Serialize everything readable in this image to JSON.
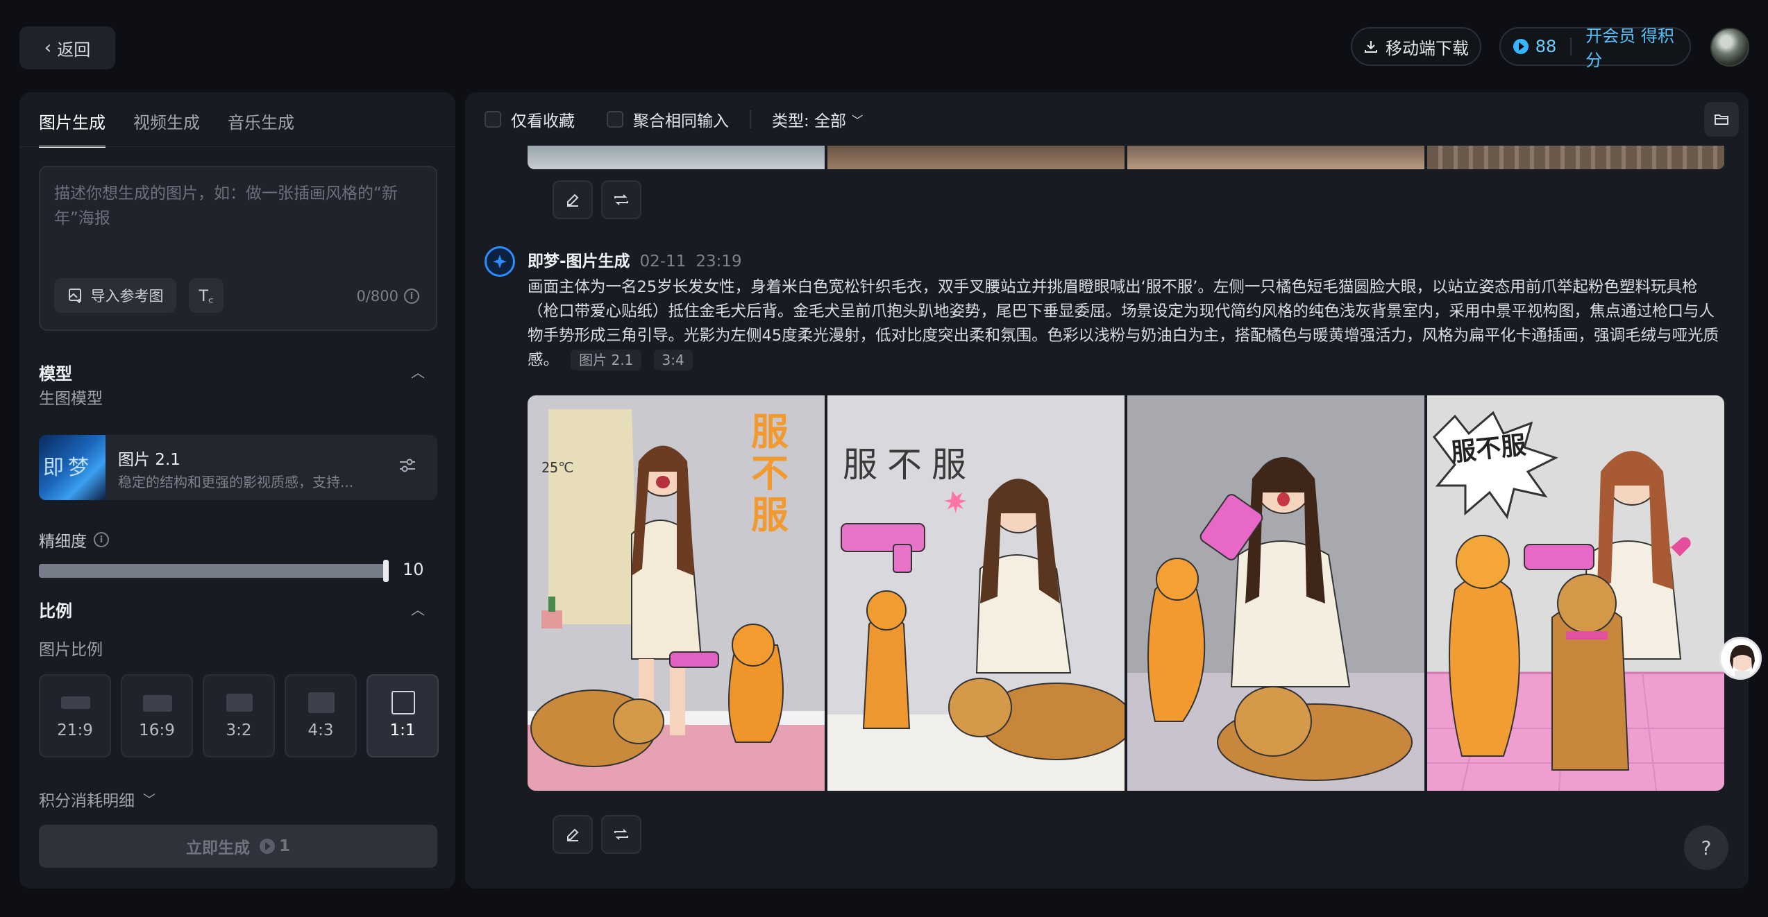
{
  "topbar": {
    "back_label": "返回",
    "mobile_download_label": "移动端下载",
    "points_value": "88",
    "membership_label": "开会员 得积分"
  },
  "left": {
    "tabs": [
      {
        "label": "图片生成",
        "active": true
      },
      {
        "label": "视频生成",
        "active": false
      },
      {
        "label": "音乐生成",
        "active": false
      }
    ],
    "prompt_placeholder": "描述你想生成的图片，如：做一张插画风格的“新年”海报",
    "import_ref_label": "导入参考图",
    "char_count": "0/800",
    "model_section_title": "模型",
    "model_sub_label": "生图模型",
    "model": {
      "thumb_text": "即梦",
      "name": "图片 2.1",
      "desc": "稳定的结构和更强的影视质感，支持..."
    },
    "fineness_label": "精细度",
    "fineness_value": "10",
    "fineness_fraction": 1.0,
    "ratio_section_title": "比例",
    "ratio_sub_label": "图片比例",
    "ratios": [
      {
        "label": "21:9",
        "active": false
      },
      {
        "label": "16:9",
        "active": false
      },
      {
        "label": "3:2",
        "active": false
      },
      {
        "label": "4:3",
        "active": false
      },
      {
        "label": "1:1",
        "active": true
      }
    ],
    "cost_detail_label": "积分消耗明细",
    "generate_label": "立即生成",
    "generate_cost": "1"
  },
  "right": {
    "filter_favorites_label": "仅看收藏",
    "filter_merge_label": "聚合相同输入",
    "filter_type_label": "类型: 全部",
    "record": {
      "author": "即梦-图片生成",
      "date": "02-11",
      "time": "23:19",
      "prompt": "画面主体为一名25岁长发女性，身着米白色宽松针织毛衣，双手叉腰站立并挑眉瞪眼喊出‘服不服’。左侧一只橘色短毛猫圆脸大眼，以站立姿态用前爪举起粉色塑料玩具枪（枪口带爱心贴纸）抵住金毛犬后背。金毛犬呈前爪抱头趴地姿势，尾巴下垂显委屈。场景设定为现代简约风格的纯色浅灰背景室内，采用中景平视构图，焦点通过枪口与人物手势形成三角引导。光影为左侧45度柔光漫射，低对比度突出柔和氛围。色彩以浅粉与奶油白为主，搭配橘色与暖黄增强活力，风格为扁平化卡通插画，强调毛绒与哑光质感。",
      "tag_model": "图片 2.1",
      "tag_ratio": "3:4"
    },
    "image_texts": {
      "img1_title": "服不服",
      "img1_temp": "25℃",
      "img2_title": "服不服",
      "img4_bubble": "服不服"
    }
  },
  "colors": {
    "accent": "#35b6ff",
    "background": "#0d0f14",
    "panel": "#181b22"
  },
  "icons": [
    "chevron-left-icon",
    "download-icon",
    "coin-icon",
    "image-import-icon",
    "text-format-icon",
    "info-icon",
    "chevron-up-icon",
    "settings-sliders-icon",
    "chevron-down-icon",
    "folder-icon",
    "edit-icon",
    "regenerate-icon",
    "help-icon"
  ]
}
